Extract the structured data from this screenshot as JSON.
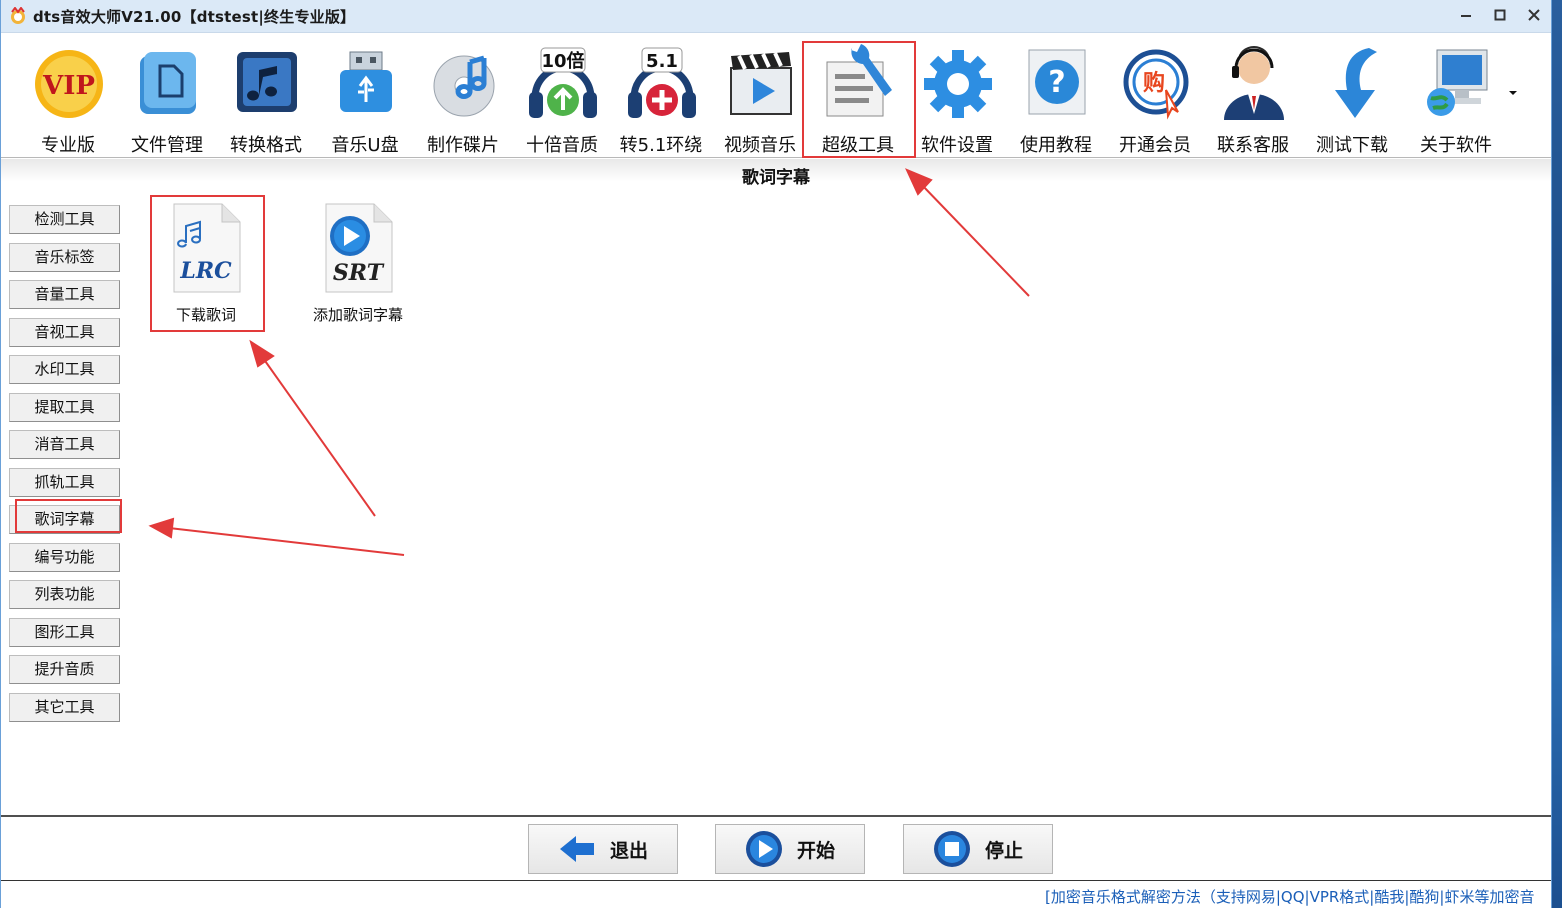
{
  "window": {
    "title": "dts音效大师V21.00【dtstest|终生专业版】"
  },
  "toolbar": {
    "items": [
      {
        "label": "专业版",
        "icon": "vip-icon"
      },
      {
        "label": "文件管理",
        "icon": "folder-icon"
      },
      {
        "label": "转换格式",
        "icon": "music-note-icon"
      },
      {
        "label": "音乐U盘",
        "icon": "usb-drive-icon"
      },
      {
        "label": "制作碟片",
        "icon": "disc-icon"
      },
      {
        "label": "十倍音质",
        "icon": "headphones-10x-icon",
        "badge": "10倍"
      },
      {
        "label": "转5.1环绕",
        "icon": "headphones-51-icon",
        "badge": "5.1"
      },
      {
        "label": "视频音乐",
        "icon": "clapperboard-icon"
      },
      {
        "label": "超级工具",
        "icon": "wrench-tools-icon"
      },
      {
        "label": "软件设置",
        "icon": "gear-icon"
      },
      {
        "label": "使用教程",
        "icon": "help-icon"
      },
      {
        "label": "开通会员",
        "icon": "buy-icon",
        "badge": "购"
      },
      {
        "label": "联系客服",
        "icon": "support-agent-icon"
      },
      {
        "label": "测试下载",
        "icon": "download-arrow-icon"
      },
      {
        "label": "关于软件",
        "icon": "computer-globe-icon"
      }
    ]
  },
  "section": {
    "title": "歌词字幕"
  },
  "sidebar": {
    "items": [
      "检测工具",
      "音乐标签",
      "音量工具",
      "音视工具",
      "水印工具",
      "提取工具",
      "消音工具",
      "抓轨工具",
      "歌词字幕",
      "编号功能",
      "列表功能",
      "图形工具",
      "提升音质",
      "其它工具"
    ],
    "selected": "歌词字幕"
  },
  "files": [
    {
      "label": "下载歌词",
      "icon_text": "LRC",
      "icon": "lrc-file-icon"
    },
    {
      "label": "添加歌词字幕",
      "icon_text": "SRT",
      "icon": "srt-file-icon"
    }
  ],
  "actions": {
    "exit": "退出",
    "start": "开始",
    "stop": "停止"
  },
  "status": {
    "link": "[加密音乐格式解密方法（支持网易|QQ|VPR格式|酷我|酷狗|虾米等加密音"
  },
  "colors": {
    "annotation": "#e23a3a",
    "link": "#1b5fb8",
    "accent": "#1e6fd0"
  }
}
